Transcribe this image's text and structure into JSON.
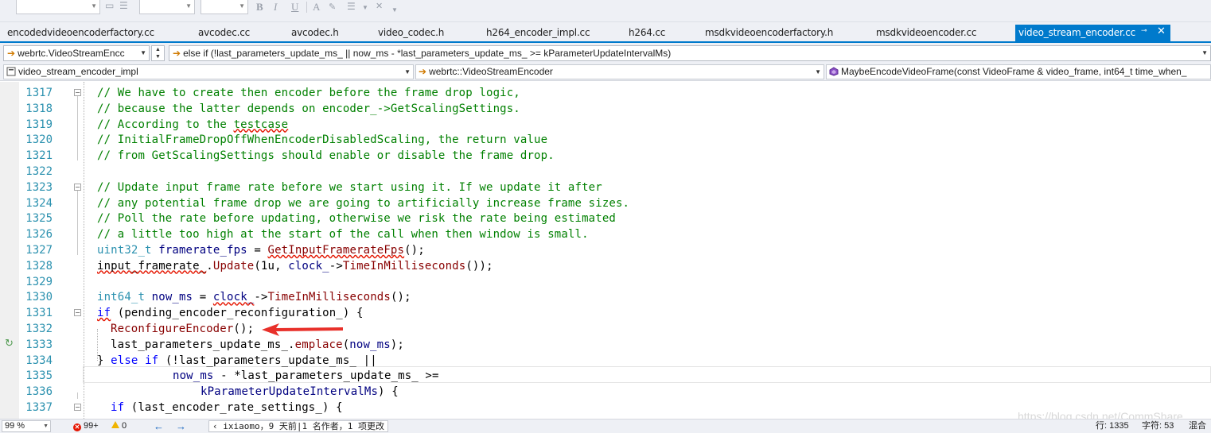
{
  "document_tabs": [
    {
      "label": "encodedvideoencoderfactory.cc",
      "active": false
    },
    {
      "label": "avcodec.cc",
      "active": false
    },
    {
      "label": "avcodec.h",
      "active": false
    },
    {
      "label": "video_codec.h",
      "active": false
    },
    {
      "label": "h264_encoder_impl.cc",
      "active": false
    },
    {
      "label": "h264.cc",
      "active": false
    },
    {
      "label": "msdkvideoencoderfactory.h",
      "active": false
    },
    {
      "label": "msdkvideoencoder.cc",
      "active": false
    },
    {
      "label": "video_stream_encoder.cc",
      "active": true
    }
  ],
  "toolbar": {
    "bold_label": "B",
    "italic_label": "I",
    "underline_label": "U",
    "font_color_label": "A"
  },
  "navbar1": {
    "scope_combo": "webrtc.VideoStreamEncc",
    "location_text": "else if (!last_parameters_update_ms_ || now_ms - *last_parameters_update_ms_ >= kParameterUpdateIntervalMs)"
  },
  "navbar2": {
    "project_combo": "video_stream_encoder_impl",
    "class_combo": "webrtc::VideoStreamEncoder",
    "member_combo": "MaybeEncodeVideoFrame(const VideoFrame & video_frame, int64_t time_when_"
  },
  "editor": {
    "line_numbers": [
      "1317",
      "1318",
      "1319",
      "1320",
      "1321",
      "1322",
      "1323",
      "1324",
      "1325",
      "1326",
      "1327",
      "1328",
      "1329",
      "1330",
      "1331",
      "1332",
      "1333",
      "1334",
      "1335",
      "1336",
      "1337"
    ],
    "lines": {
      "l1317": "// We have to create then encoder before the frame drop logic,",
      "l1318": "// because the latter depends on encoder_->GetScalingSettings.",
      "l1319a": "// According to the ",
      "l1319b": "testcase",
      "l1320": "// InitialFrameDropOffWhenEncoderDisabledScaling, the return value",
      "l1321": "// from GetScalingSettings should enable or disable the frame drop.",
      "l1323": "// Update input frame rate before we start using it. If we update it after",
      "l1324": "// any potential frame drop we are going to artificially increase frame sizes.",
      "l1325": "// Poll the rate before updating, otherwise we risk the rate being estimated",
      "l1326": "// a little too high at the start of the call when then window is small.",
      "l1327_type": "uint32_t",
      "l1327_var": "framerate_fps",
      "l1327_eq": " = ",
      "l1327_fn": "GetInputFramerateFps",
      "l1327_end": "();",
      "l1328_var": "input_framerate_",
      "l1328_dot": ".",
      "l1328_fn": "Update",
      "l1328_args1": "(1u, ",
      "l1328_var2": "clock_",
      "l1328_arrow": "->",
      "l1328_fn2": "TimeInMilliseconds",
      "l1328_end": "());",
      "l1330_type": "int64_t",
      "l1330_var": "now_ms",
      "l1330_eq": " = ",
      "l1330_var2": "clock_",
      "l1330_arrow": "->",
      "l1330_fn": "TimeInMilliseconds",
      "l1330_end": "();",
      "l1331_kw": "if",
      "l1331_rest": " (pending_encoder_reconfiguration_) {",
      "l1332_fn": "ReconfigureEncoder",
      "l1332_end": "();",
      "l1333_var": "last_parameters_update_ms_",
      "l1333_dot": ".",
      "l1333_fn": "emplace",
      "l1333_open": "(",
      "l1333_var2": "now_ms",
      "l1333_end": ");",
      "l1334_brace": "} ",
      "l1334_kw1": "else",
      "l1334_sp": " ",
      "l1334_kw2": "if",
      "l1334_rest": " (!last_parameters_update_ms_ ||",
      "l1335_var": "now_ms",
      "l1335_rest": " - *last_parameters_update_ms_ >=",
      "l1336_var": "kParameterUpdateIntervalMs",
      "l1336_rest": ") {",
      "l1337_kw": "if",
      "l1337_rest": " (last_encoder_rate_settings_) {"
    },
    "watermark": "https://blog.csdn.net/CommShare"
  },
  "statusbar": {
    "zoom": "99 %",
    "errors": "99+",
    "warnings": "0",
    "blame": "ixiaomo，9 天前|1 名作者，1 项更改",
    "line": "行: 1335",
    "char": "字符: 53",
    "mode": "混合"
  },
  "colors": {
    "accent": "#007acc",
    "comment": "#008000",
    "keyword": "#0000ff",
    "type": "#2b91af",
    "function": "#880000",
    "variable": "#000080",
    "arrow_annotation": "#e8302a"
  }
}
